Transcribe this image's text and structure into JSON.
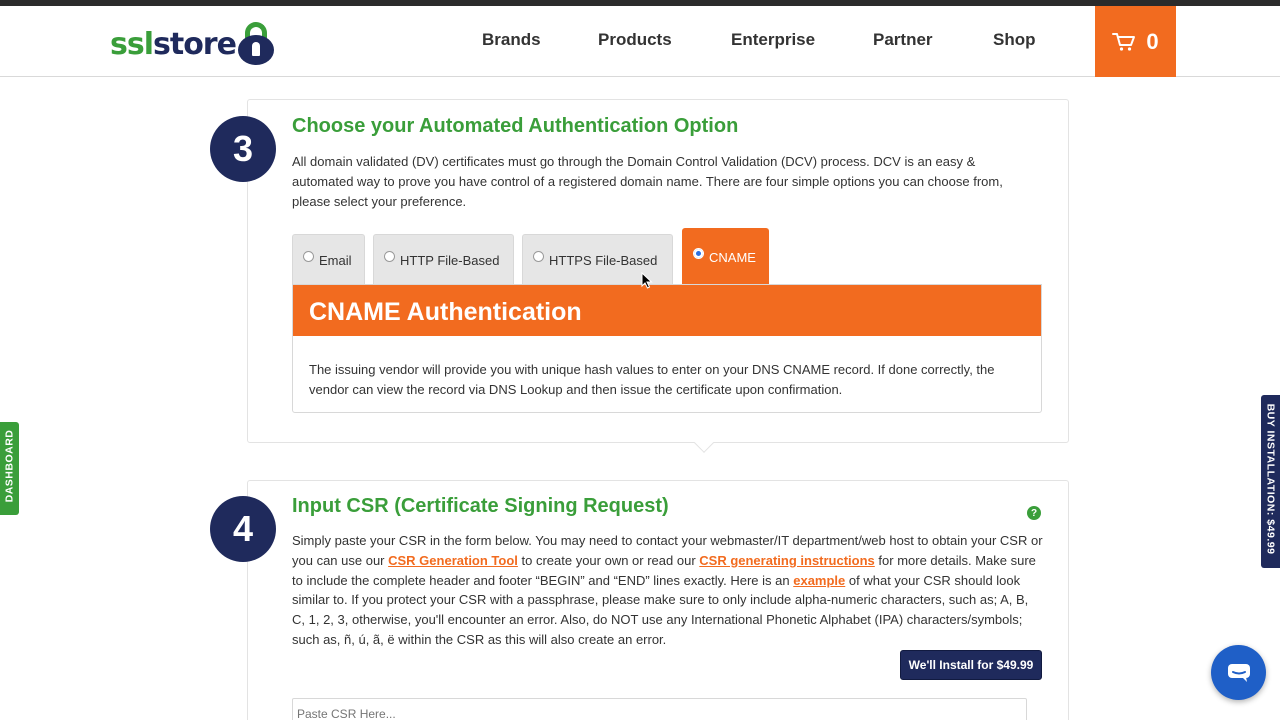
{
  "header": {
    "logo": {
      "ssl": "ssl",
      "store": "store"
    },
    "nav": [
      "Brands",
      "Products",
      "Enterprise",
      "Partner",
      "Shop"
    ],
    "cart": {
      "icon": "cart-icon",
      "count": "0"
    }
  },
  "step3": {
    "number": "3",
    "title": "Choose your Automated Authentication Option",
    "description": "All domain validated (DV) certificates must go through the Domain Control Validation (DCV) process. DCV is an easy & automated way to prove you have control of a registered domain name. There are four simple options you can choose from, please select your preference.",
    "tabs": [
      {
        "label": "Email",
        "selected": false
      },
      {
        "label": "HTTP File-Based",
        "selected": false
      },
      {
        "label": "HTTPS File-Based",
        "selected": false
      },
      {
        "label": "CNAME",
        "selected": true
      }
    ],
    "panel": {
      "title": "CNAME Authentication",
      "text": "The issuing vendor will provide you with unique hash values to enter on your DNS CNAME record. If done correctly, the vendor can view the record via DNS Lookup and then issue the certificate upon confirmation."
    }
  },
  "step4": {
    "number": "4",
    "title": "Input CSR (Certificate Signing Request)",
    "help": "?",
    "text_1": "Simply paste your CSR in the form below. You may need to contact your webmaster/IT department/web host to obtain your CSR or you can use our ",
    "link_1": "CSR Generation Tool",
    "text_2": " to create your own or read our ",
    "link_2": "CSR generating instructions",
    "text_3": " for more details. Make sure to include the complete header and footer “BEGIN” and “END” lines exactly. Here is an ",
    "link_3": "example",
    "text_4": " of what your CSR should look similar to. If you protect your CSR with a passphrase, please make sure to only include alpha-numeric characters, such as; A, B, C, 1, 2, 3, otherwise, you'll encounter an error. Also, do NOT use any International Phonetic Alphabet (IPA) characters/symbols; such as, ñ, ú, ã, ë within the CSR as this will also create an error.",
    "install_button": "We'll Install for $49.99",
    "csr_placeholder": "Paste CSR Here..."
  },
  "side_tabs": {
    "dashboard": "DASHBOARD",
    "buy_installation": "BUY INSTALLATION: $49.99"
  },
  "colors": {
    "brand_green": "#3a9e3a",
    "brand_navy": "#1f2a5c",
    "accent_orange": "#f26b1f",
    "chat_blue": "#1f5fc7"
  }
}
